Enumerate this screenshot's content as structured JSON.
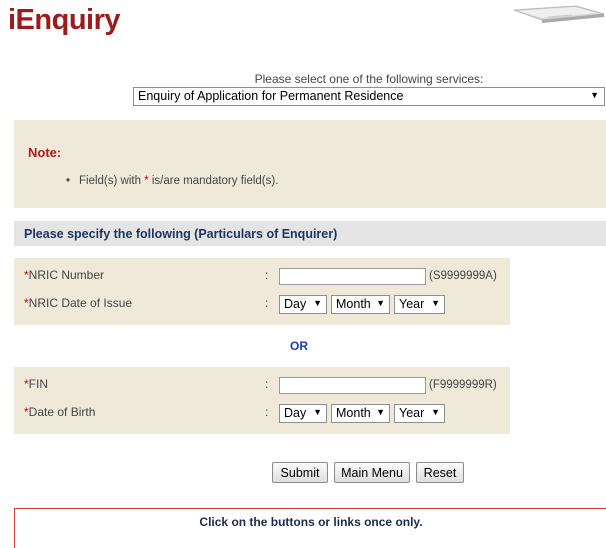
{
  "header": {
    "title": "iEnquiry"
  },
  "service": {
    "label": "Please select one of the following services:",
    "selected": "Enquiry of Application for Permanent Residence"
  },
  "note": {
    "title": "Note:",
    "item_prefix": "Field(s) with ",
    "item_star": "*",
    "item_suffix": " is/are mandatory field(s)."
  },
  "section": {
    "title": "Please specify the following (Particulars of Enquirer)"
  },
  "form": {
    "nric_number": {
      "star": "*",
      "label": "NRIC Number",
      "colon": ":",
      "value": "",
      "hint": "(S9999999A)"
    },
    "nric_issue": {
      "star": "*",
      "label": "NRIC Date of Issue",
      "colon": ":",
      "day": "Day",
      "month": "Month",
      "year": "Year"
    },
    "or": "OR",
    "fin": {
      "star": "*",
      "label": "FIN",
      "colon": ":",
      "value": "",
      "hint": "(F9999999R)"
    },
    "dob": {
      "star": "*",
      "label": "Date of Birth",
      "colon": ":",
      "day": "Day",
      "month": "Month",
      "year": "Year"
    }
  },
  "buttons": {
    "submit": "Submit",
    "main_menu": "Main Menu",
    "reset": "Reset"
  },
  "warning": {
    "text": "Click on the buttons or links once only."
  },
  "icons": {
    "dropdown_arrow": "▼"
  },
  "colors": {
    "brand": "#9b1b1e",
    "panel": "#eee9d9",
    "section_header": "#e4e4e4",
    "or_link": "#1a3fb8",
    "mandatory": "#cc0000"
  }
}
